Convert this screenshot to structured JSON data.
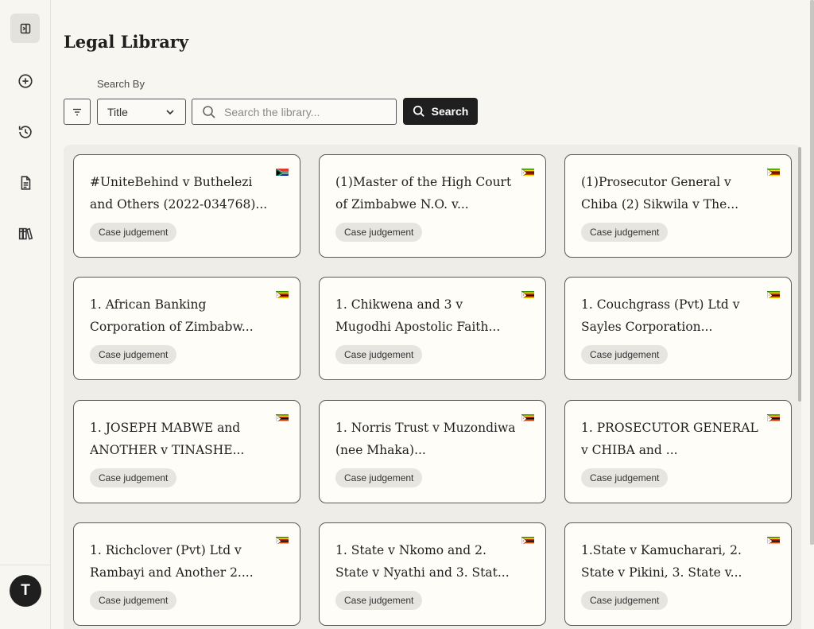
{
  "page": {
    "title": "Legal Library"
  },
  "sidebar": {
    "items": [
      {
        "name": "toggle-sidebar",
        "icon": "sidebar-toggle-icon"
      },
      {
        "name": "new-item",
        "icon": "plus-circle-icon"
      },
      {
        "name": "history",
        "icon": "history-icon"
      },
      {
        "name": "documents",
        "icon": "document-icon"
      },
      {
        "name": "library",
        "icon": "library-icon"
      }
    ],
    "avatar_initial": "T"
  },
  "search": {
    "label": "Search By",
    "field_selected": "Title",
    "placeholder": "Search the library...",
    "button_label": "Search"
  },
  "cards": [
    {
      "title": "#UniteBehind v Buthelezi and Others (2022-034768)...",
      "badge": "Case judgement",
      "flag": "south-africa"
    },
    {
      "title": "(1)Master of the High Court of Zimbabwe N.O. v...",
      "badge": "Case judgement",
      "flag": "zimbabwe"
    },
    {
      "title": "(1)Prosecutor General v Chiba (2) Sikwila v The...",
      "badge": "Case judgement",
      "flag": "zimbabwe"
    },
    {
      "title": "1. African Banking Corporation of Zimbabw...",
      "badge": "Case judgement",
      "flag": "zimbabwe"
    },
    {
      "title": "1. Chikwena and 3 v Mugodhi Apostolic Faith...",
      "badge": "Case judgement",
      "flag": "zimbabwe"
    },
    {
      "title": "1. Couchgrass (Pvt) Ltd v Sayles Corporation...",
      "badge": "Case judgement",
      "flag": "zimbabwe"
    },
    {
      "title": "1. JOSEPH MABWE and ANOTHER v TINASHE...",
      "badge": "Case judgement",
      "flag": "zimbabwe"
    },
    {
      "title": "1. Norris Trust v Muzondiwa (nee Mhaka)...",
      "badge": "Case judgement",
      "flag": "zimbabwe"
    },
    {
      "title": "1. PROSECUTOR GENERAL v CHIBA and ...",
      "badge": "Case judgement",
      "flag": "zimbabwe"
    },
    {
      "title": "1. Richclover (Pvt) Ltd v Rambayi and Another 2....",
      "badge": "Case judgement",
      "flag": "zimbabwe"
    },
    {
      "title": "1. State v Nkomo and 2. State v Nyathi and 3. Stat...",
      "badge": "Case judgement",
      "flag": "zimbabwe"
    },
    {
      "title": "1.State v Kamucharari, 2. State v Pikini, 3. State v...",
      "badge": "Case judgement",
      "flag": "zimbabwe"
    }
  ]
}
